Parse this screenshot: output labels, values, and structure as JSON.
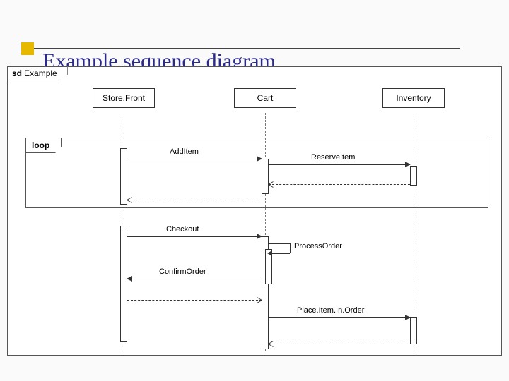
{
  "slide": {
    "title": "Example sequence diagram"
  },
  "frame": {
    "prefix": "sd",
    "name": "Example"
  },
  "lifelines": {
    "l1": "Store.Front",
    "l2": "Cart",
    "l3": "Inventory"
  },
  "fragments": {
    "loop": "loop"
  },
  "messages": {
    "m1": "AddItem",
    "m2": "ReserveItem",
    "m3": "Checkout",
    "m4": "ConfirmOrder",
    "m5": "ProcessOrder",
    "m6": "Place.Item.In.Order"
  },
  "chart_data": {
    "type": "sequence_diagram",
    "title": "Example",
    "lifelines": [
      "Store.Front",
      "Cart",
      "Inventory"
    ],
    "fragments": [
      {
        "type": "loop",
        "label": "loop",
        "messages": [
          {
            "from": "Store.Front",
            "to": "Cart",
            "label": "AddItem",
            "kind": "sync"
          },
          {
            "from": "Cart",
            "to": "Inventory",
            "label": "ReserveItem",
            "kind": "sync"
          },
          {
            "from": "Inventory",
            "to": "Cart",
            "label": "",
            "kind": "return"
          },
          {
            "from": "Cart",
            "to": "Store.Front",
            "label": "",
            "kind": "return"
          }
        ]
      }
    ],
    "messages": [
      {
        "from": "Store.Front",
        "to": "Cart",
        "label": "Checkout",
        "kind": "sync"
      },
      {
        "from": "Cart",
        "to": "Cart",
        "label": "ProcessOrder",
        "kind": "self"
      },
      {
        "from": "Cart",
        "to": "Store.Front",
        "label": "ConfirmOrder",
        "kind": "sync"
      },
      {
        "from": "Store.Front",
        "to": "Cart",
        "label": "",
        "kind": "return"
      },
      {
        "from": "Cart",
        "to": "Inventory",
        "label": "Place.Item.In.Order",
        "kind": "sync"
      },
      {
        "from": "Inventory",
        "to": "Cart",
        "label": "",
        "kind": "return"
      }
    ]
  }
}
